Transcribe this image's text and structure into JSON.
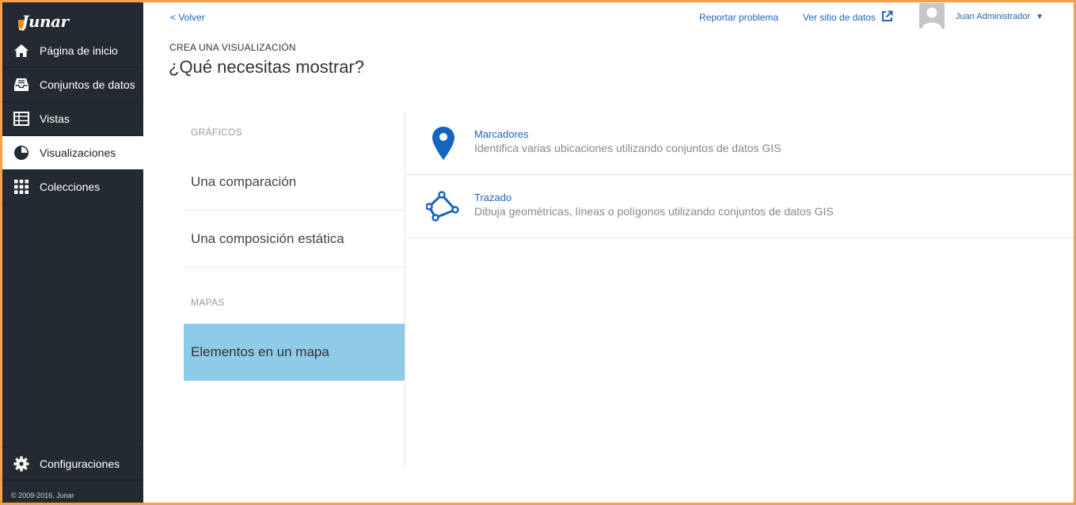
{
  "brand": {
    "logo_text": "Junar",
    "accent": "#f08a24",
    "sidebar_bg": "#232a31"
  },
  "sidebar": {
    "items": [
      {
        "label": "Página de inicio",
        "icon": "home-icon"
      },
      {
        "label": "Conjuntos de datos",
        "icon": "inbox-icon"
      },
      {
        "label": "Vistas",
        "icon": "table-icon"
      },
      {
        "label": "Visualizaciones",
        "icon": "pie-chart-icon",
        "active": true
      },
      {
        "label": "Colecciones",
        "icon": "grid-icon"
      }
    ],
    "settings_label": "Configuraciones",
    "copyright": "© 2009-2016, Junar"
  },
  "topbar": {
    "back_label": "< Volver",
    "report_label": "Reportar problema",
    "site_label": "Ver sitio de datos",
    "user_name": "Juan Administrador",
    "caret": "▼"
  },
  "heading": {
    "kicker": "CREA UNA VISUALIZACIÓN",
    "title": "¿Qué necesitas mostrar?"
  },
  "left": {
    "charts_section": "GRÁFICOS",
    "comparison": "Una comparación",
    "composition": "Una composición estática",
    "maps_section": "MAPAS",
    "map_elements": "Elementos en un mapa",
    "selected_color": "#8ecbe9"
  },
  "right": {
    "items": [
      {
        "title": "Marcadores",
        "description": "Identifica varias ubicaciones utilizando conjuntos de datos GIS",
        "icon": "map-pin-icon"
      },
      {
        "title": "Trazado",
        "description": "Dibuja geométricas, líneas o polígonos utilizando conjuntos de datos GIS",
        "icon": "polygon-icon"
      }
    ]
  }
}
